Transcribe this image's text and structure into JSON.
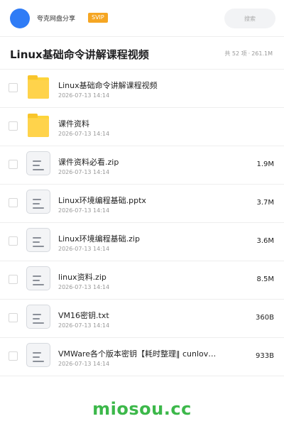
{
  "header": {
    "share_name": "夸克网盘分享",
    "badge": "SVIP",
    "search_placeholder": "搜索",
    "colors": {
      "avatar": "#2f7cf6",
      "badge": "#f5a623"
    }
  },
  "title": "Linux基础命令讲解课程视频",
  "meta": {
    "count": "共 52 项",
    "separator": "·",
    "total_size": "261.1M"
  },
  "files": [
    {
      "type": "folder",
      "name": "Linux基础命令讲解课程视频",
      "date": "2026-07-13 14:14",
      "size": ""
    },
    {
      "type": "folder",
      "name": "课件资料",
      "date": "2026-07-13 14:14",
      "size": ""
    },
    {
      "type": "file",
      "name": "课件资料必看.zip",
      "date": "2026-07-13 14:14",
      "size": "1.9M"
    },
    {
      "type": "file",
      "name": "Linux环境编程基础.pptx",
      "date": "2026-07-13 14:14",
      "size": "3.7M"
    },
    {
      "type": "file",
      "name": "Linux环境编程基础.zip",
      "date": "2026-07-13 14:14",
      "size": "3.6M"
    },
    {
      "type": "file",
      "name": "linux资料.zip",
      "date": "2026-07-13 14:14",
      "size": "8.5M"
    },
    {
      "type": "file",
      "name": "VM16密钥.txt",
      "date": "2026-07-13 14:14",
      "size": "360B"
    },
    {
      "type": "file",
      "name": "VMWare各个版本密钥【耗时整理‖ cunlov…",
      "date": "2026-07-13 14:14",
      "size": "933B"
    }
  ],
  "watermark": "miosou.cc"
}
